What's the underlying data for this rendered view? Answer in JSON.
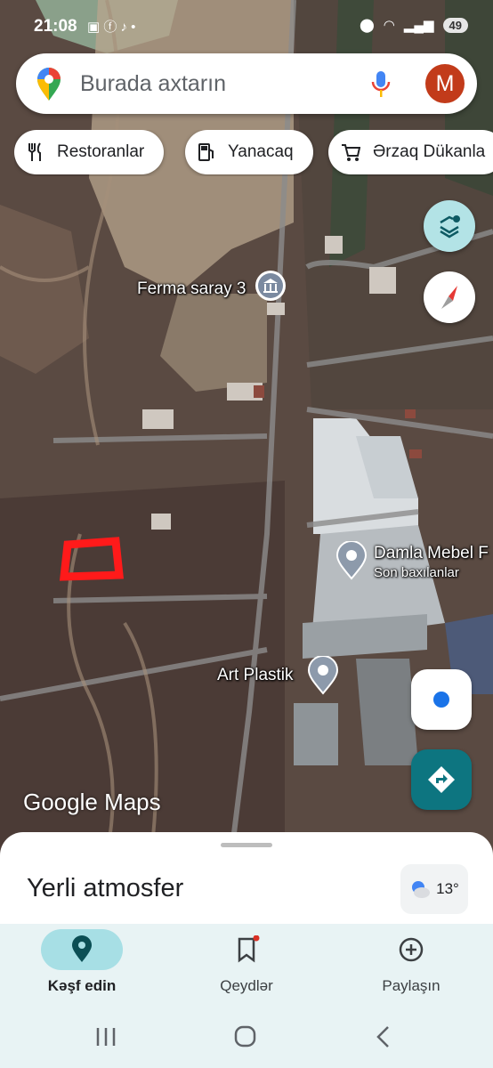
{
  "status_bar": {
    "time": "21:08",
    "battery": "49"
  },
  "search": {
    "placeholder": "Burada axtarın",
    "avatar_letter": "M"
  },
  "chips": [
    {
      "label": "Restoranlar",
      "icon": "restaurant-icon"
    },
    {
      "label": "Yanacaq",
      "icon": "gas-station-icon"
    },
    {
      "label": "Ərzaq Dükanla",
      "icon": "grocery-cart-icon"
    }
  ],
  "map": {
    "places": [
      {
        "name": "Ferma saray 3",
        "icon": "museum-icon"
      },
      {
        "name": "Damla Mebel F",
        "subtitle": "Son baxılanlar",
        "icon": "place-pin-icon"
      },
      {
        "name": "Art Plastik",
        "icon": "place-pin-icon"
      }
    ],
    "logo": "Google Maps",
    "highlight_color": "#ff1a1a"
  },
  "sheet": {
    "title": "Yerli atmosfer",
    "weather_temp": "13°"
  },
  "nav": {
    "items": [
      {
        "label": "Kəşf edin",
        "icon": "explore-pin-icon",
        "active": true
      },
      {
        "label": "Qeydlər",
        "icon": "bookmark-icon",
        "active": false
      },
      {
        "label": "Paylaşın",
        "icon": "add-circle-icon",
        "active": false
      }
    ]
  },
  "colors": {
    "accent": "#0d7580",
    "nav_active": "#a7dfe5",
    "avatar": "#c23b1a",
    "location_dot": "#1a73e8"
  }
}
